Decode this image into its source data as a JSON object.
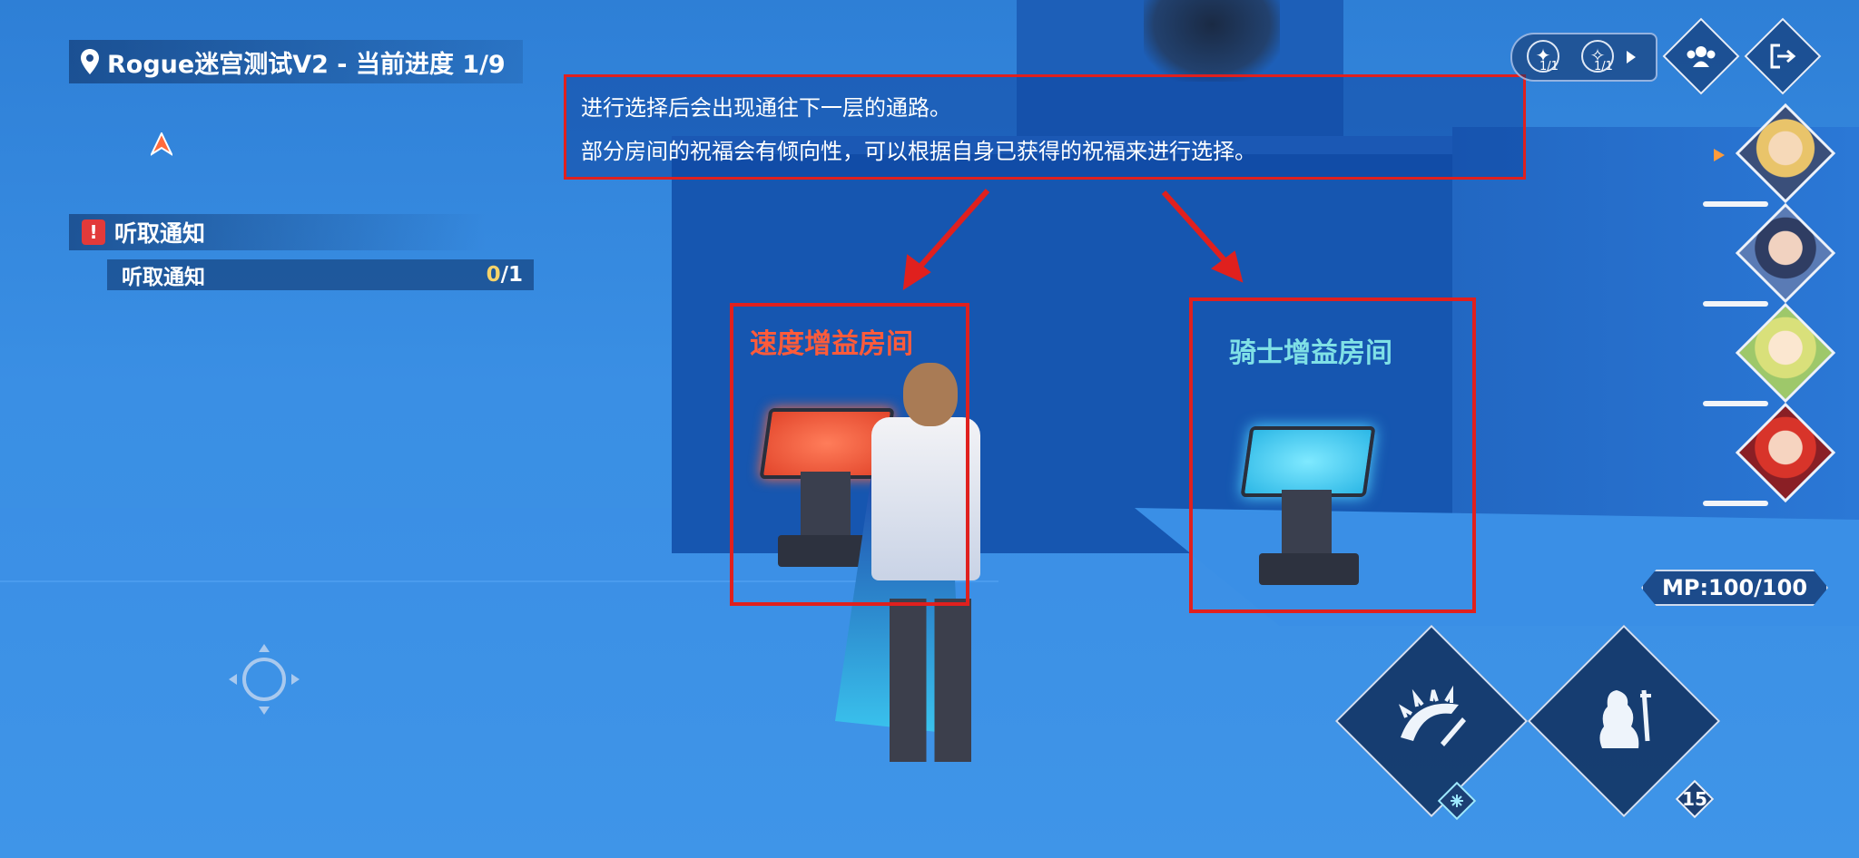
{
  "quest": {
    "title": "Rogue迷宫测试V2 - 当前进度 1/9"
  },
  "task": {
    "title": "听取通知",
    "item_label": "听取通知",
    "progress_current": "0",
    "progress_total": "/1"
  },
  "tutorial": {
    "line1": "进行选择后会出现通往下一层的通路。",
    "line2": "部分房间的祝福会有倾向性，可以根据自身已获得的祝福来进行选择。"
  },
  "rooms": {
    "speed_label": "速度增益房间",
    "knight_label": "骑士增益房间"
  },
  "status": {
    "stat1_count": "1/1",
    "stat2_count": "1/1"
  },
  "mp": {
    "label": "MP:100/100"
  },
  "skills": {
    "skill2_count": "15"
  },
  "colors": {
    "highlight_red": "#e0201e",
    "speed_room": "#ff5b3a",
    "knight_room": "#7fe0e6"
  }
}
